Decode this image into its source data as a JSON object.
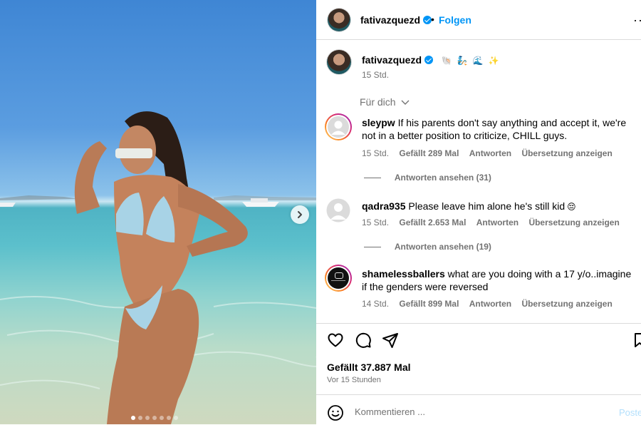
{
  "media": {
    "slide_count": 7,
    "active_slide": 1,
    "next_icon": "chevron-right-icon"
  },
  "header": {
    "username": "fativazquezd",
    "bullet": "•",
    "follow_label": "Folgen",
    "more_icon": "ellipsis-icon",
    "more_label": "···"
  },
  "caption": {
    "username": "fativazquezd",
    "emojis": [
      "🐚",
      "🧞",
      "🌊",
      "✨"
    ],
    "time": "15 Std."
  },
  "filter": {
    "label": "Für dich"
  },
  "comments": [
    {
      "username": "sleypw",
      "text": "If his parents don't say anything and accept it, we're not in a better position to criticize, CHILL guys.",
      "time": "15 Std.",
      "likes": "Gefällt 289 Mal",
      "reply": "Antworten",
      "translate": "Übersetzung anzeigen",
      "view_replies": "Antworten ansehen (31)"
    },
    {
      "username": "qadra935",
      "text": "Please leave him alone he's still kid",
      "emoji": "😔",
      "time": "15 Std.",
      "likes": "Gefällt 2.653 Mal",
      "reply": "Antworten",
      "translate": "Übersetzung anzeigen",
      "view_replies": "Antworten ansehen (19)"
    },
    {
      "username": "shamelessballers",
      "text": "what are you doing with a 17 y/o..imagine if the genders were reversed",
      "time": "14 Std.",
      "likes": "Gefällt 899 Mal",
      "reply": "Antworten",
      "translate": "Übersetzung anzeigen"
    }
  ],
  "footer": {
    "likes": "Gefällt 37.887 Mal",
    "ago": "Vor 15 Stunden",
    "comment_placeholder": "Kommentieren ...",
    "post_label": "Posten"
  },
  "colors": {
    "accent": "#0095f6",
    "muted": "#737373",
    "divider": "#dbdbdb"
  }
}
